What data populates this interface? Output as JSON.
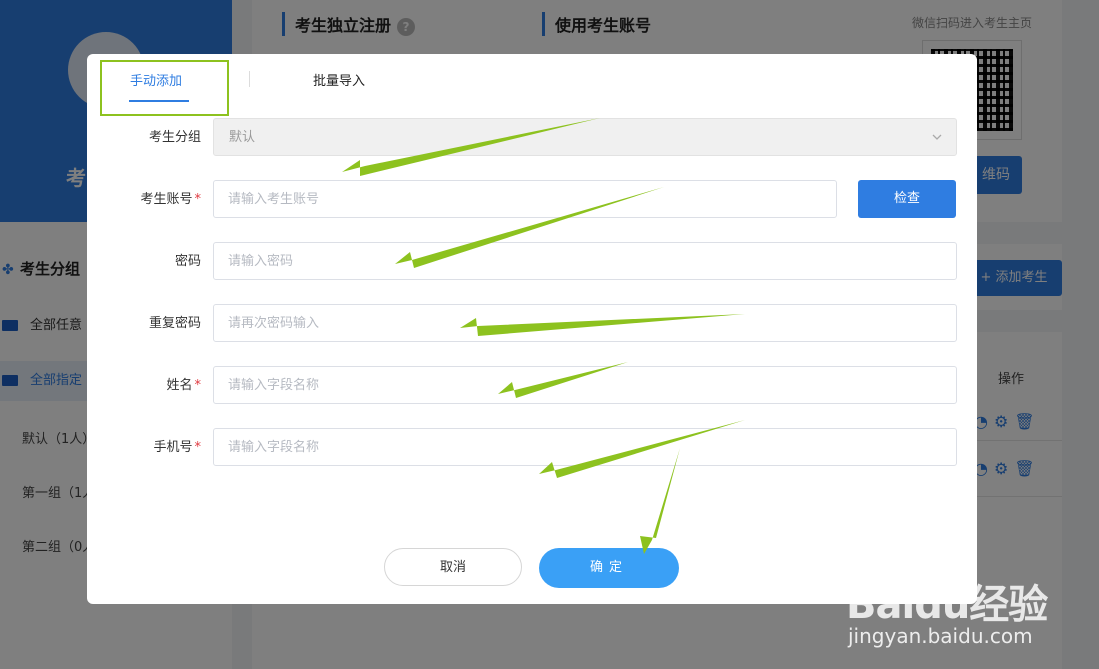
{
  "background": {
    "profile_name": "考",
    "groups_title": "考生分组",
    "nav": [
      "全部任意",
      "全部指定"
    ],
    "sub_groups": [
      "默认（1人）",
      "第一组（1人",
      "第二组（0人"
    ],
    "tabs": [
      "考生独立注册",
      "使用考生账号"
    ],
    "help": "?",
    "wechat_tip": "微信扫码进入考生主页",
    "qr_button": "维码",
    "add_button": "+ 添加考生",
    "op_header": "操作"
  },
  "modal": {
    "tabs": {
      "manual": "手动添加",
      "batch": "批量导入"
    },
    "fields": {
      "group": {
        "label": "考生分组",
        "value": "默认"
      },
      "account": {
        "label": "考生账号",
        "placeholder": "请输入考生账号",
        "check": "检查"
      },
      "password": {
        "label": "密码",
        "placeholder": "请输入密码"
      },
      "repeat": {
        "label": "重复密码",
        "placeholder": "请再次密码输入"
      },
      "name": {
        "label": "姓名",
        "placeholder": "请输入字段名称"
      },
      "phone": {
        "label": "手机号",
        "placeholder": "请输入字段名称"
      }
    },
    "required_mark": "*",
    "cancel": "取消",
    "confirm": "确定"
  },
  "watermark": {
    "logo": "Baidu经验",
    "url": "jingyan.baidu.com"
  },
  "colors": {
    "primary": "#2f7de1",
    "confirm": "#3aa0f6",
    "arrow": "#8dc21f",
    "required": "#e0383e"
  }
}
